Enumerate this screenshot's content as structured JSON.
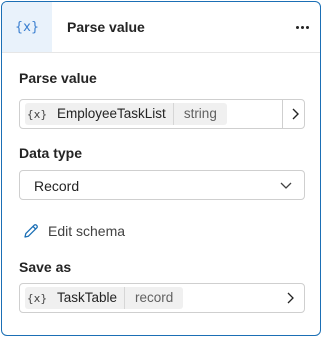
{
  "header": {
    "icon": "{x}",
    "title": "Parse value",
    "more_icon": "more-horizontal-icon"
  },
  "parse_value": {
    "label": "Parse value",
    "var_icon": "{x}",
    "variable_name": "EmployeeTaskList",
    "variable_type": "string"
  },
  "data_type": {
    "label": "Data type",
    "selected": "Record"
  },
  "edit_schema": {
    "label": "Edit schema"
  },
  "save_as": {
    "label": "Save as",
    "var_icon": "{x}",
    "variable_name": "TaskTable",
    "variable_type": "record"
  },
  "colors": {
    "accent": "#1b6fb5",
    "header_icon_bg": "#e9f2fb",
    "tag_bg": "#f0f0f0"
  }
}
